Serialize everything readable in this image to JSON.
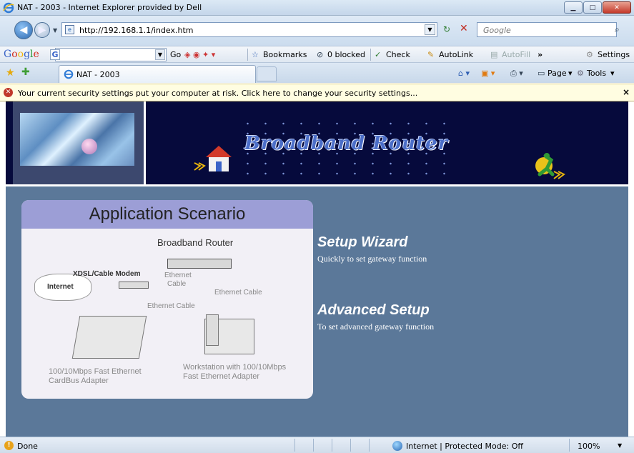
{
  "window": {
    "title": "NAT - 2003 - Internet Explorer provided by Dell",
    "buttons": {
      "minimize": "▁",
      "maximize": "□",
      "close": "✕"
    }
  },
  "address_bar": {
    "url": "http://192.168.1.1/index.htm",
    "search_placeholder": "Google"
  },
  "google_toolbar": {
    "logo": {
      "G": "G",
      "o1": "o",
      "o2": "o",
      "g": "g",
      "l": "l",
      "e": "e"
    },
    "search_badge": "G",
    "go": "Go",
    "bookmarks": "Bookmarks",
    "blocked": "0 blocked",
    "check": "Check",
    "autolink": "AutoLink",
    "autofill": "AutoFill",
    "more": "»",
    "settings": "Settings"
  },
  "tabs": {
    "active_tab": "NAT - 2003"
  },
  "command_bar": {
    "page": "Page",
    "tools": "Tools"
  },
  "infobar": {
    "message": "Your current security settings put your computer at risk. Click here to change your security settings...",
    "close": "×"
  },
  "page": {
    "banner_title": "Broadband Router",
    "scenario": {
      "title": "Application Scenario",
      "labels": {
        "router": "Broadband Router",
        "modem": "XDSL/Cable Modem",
        "internet": "Internet",
        "ethernet_cable_a": "Ethernet",
        "ethernet_cable_b": "Cable",
        "ethernet_cable_right": "Ethernet Cable",
        "ethernet_cable_left": "Ethernet Cable",
        "laptop_line1": "100/10Mbps Fast Ethernet",
        "laptop_line2": "CardBus Adapter",
        "workstation_line1": "Workstation with 100/10Mbps",
        "workstation_line2": "Fast Ethernet Adapter"
      }
    },
    "menu": [
      {
        "title": "Setup Wizard",
        "description": "Quickly to set gateway function"
      },
      {
        "title": "Advanced Setup",
        "description": "To set advanced gateway function"
      }
    ]
  },
  "status_bar": {
    "status": "Done",
    "zone": "Internet | Protected Mode: Off",
    "zoom": "100%"
  }
}
